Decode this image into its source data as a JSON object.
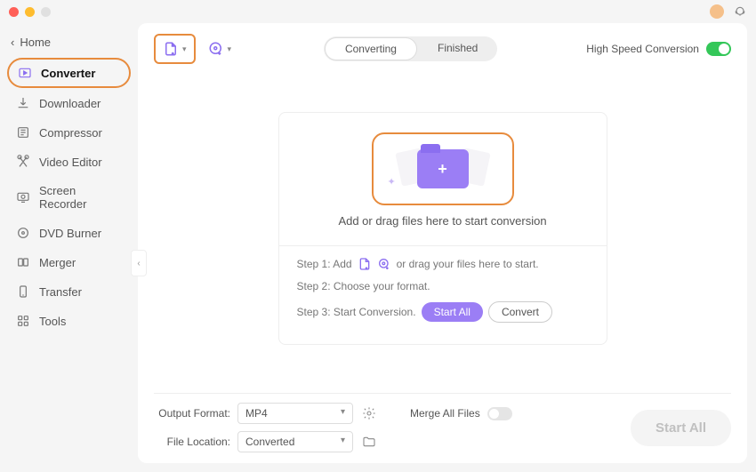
{
  "header": {
    "home": "Home"
  },
  "sidebar": {
    "items": [
      {
        "label": "Converter",
        "icon": "converter-icon"
      },
      {
        "label": "Downloader",
        "icon": "downloader-icon"
      },
      {
        "label": "Compressor",
        "icon": "compressor-icon"
      },
      {
        "label": "Video Editor",
        "icon": "video-editor-icon"
      },
      {
        "label": "Screen Recorder",
        "icon": "screen-recorder-icon"
      },
      {
        "label": "DVD Burner",
        "icon": "dvd-burner-icon"
      },
      {
        "label": "Merger",
        "icon": "merger-icon"
      },
      {
        "label": "Transfer",
        "icon": "transfer-icon"
      },
      {
        "label": "Tools",
        "icon": "tools-icon"
      }
    ]
  },
  "toolbar": {
    "tabs": {
      "converting": "Converting",
      "finished": "Finished"
    },
    "high_speed_label": "High Speed Conversion"
  },
  "dropzone": {
    "main_label": "Add or drag files here to start conversion",
    "step1_prefix": "Step 1: Add",
    "step1_suffix": "or drag your files here to start.",
    "step2": "Step 2: Choose your format.",
    "step3_prefix": "Step 3: Start Conversion.",
    "start_all": "Start  All",
    "convert": "Convert"
  },
  "footer": {
    "output_format_label": "Output Format:",
    "output_format_value": "MP4",
    "file_location_label": "File Location:",
    "file_location_value": "Converted",
    "merge_label": "Merge All Files",
    "start_all": "Start All"
  }
}
